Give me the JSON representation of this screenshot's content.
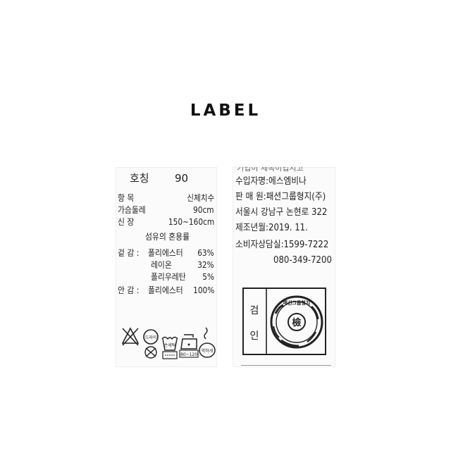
{
  "heading": "LABEL",
  "left_label": {
    "size_label": "호칭",
    "size_value": "90",
    "col_item": "항     목",
    "col_body": "신체치수",
    "chest_label": "가슴둘레",
    "chest_value": "90cm",
    "height_label": "신     장",
    "height_value": "150~160cm",
    "fiber_title": "섬유의 혼용률",
    "outer_label": "겉  감 :",
    "lining_label": "안  감 :",
    "outer_fibers": [
      {
        "name": "폴리에스터",
        "pct": "63%"
      },
      {
        "name": "레이온",
        "pct": "32%"
      },
      {
        "name": "폴리우레탄",
        "pct": "5%"
      }
    ],
    "lining_fiber": {
      "name": "폴리에스터",
      "pct": "100%"
    },
    "care_symbols": [
      {
        "name": "no-bleach",
        "text": ""
      },
      {
        "name": "dry-clean",
        "text": "드라이"
      },
      {
        "name": "hand-wash",
        "text": "손세탁"
      },
      {
        "name": "iron",
        "text": "80~120"
      },
      {
        "name": "wring-gently",
        "text": "약하게"
      }
    ],
    "colors": {
      "ink": "#222222",
      "paper": "#fbfbfb"
    }
  },
  "right_label": {
    "cut_top": "기업이 제목이업지고",
    "importer": "수입자명:에스엠비나",
    "seller": "판 매 원:패션그룹형지(주)",
    "address": "서울시 강남구 논현로 322",
    "made_date": "제조년월:2019. 11.",
    "consumer_center": "소비자상담실:1599-7222",
    "phone": "080-349-7200",
    "inspection_chars": [
      "검",
      "인"
    ],
    "seal_text": "패션그룹형지",
    "seal_center": "檢"
  }
}
